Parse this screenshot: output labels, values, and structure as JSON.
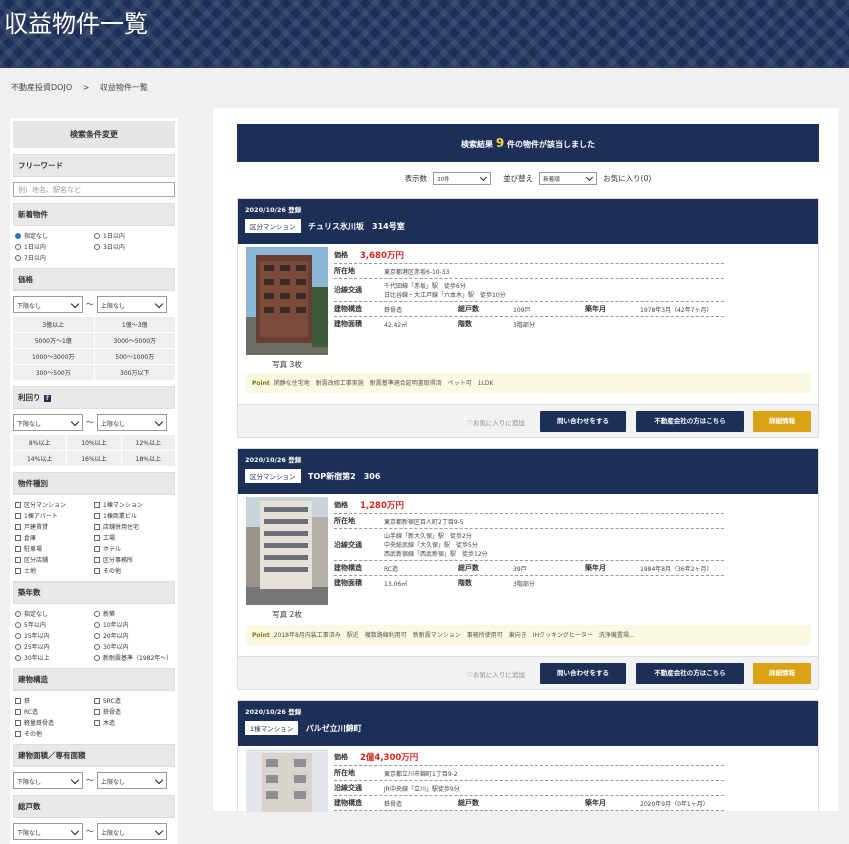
{
  "header": {
    "title": "収益物件一覧"
  },
  "breadcrumb": {
    "home": "不動産投資DOJO",
    "separator": ">",
    "current": "収益物件一覧"
  },
  "sidebar": {
    "title": "検索条件変更",
    "freeword": {
      "heading": "フリーワード",
      "placeholder": "例）地名、駅名など"
    },
    "new": {
      "heading": "新着物件",
      "options": [
        "指定なし",
        "1日以内",
        "7日以内",
        "1日以内",
        "3日以内"
      ]
    },
    "price": {
      "heading": "価格",
      "min": "下限なし",
      "tilde": "～",
      "max": "上限なし",
      "quick": [
        "3億以上",
        "1億～3億",
        "5000万～1億",
        "3000～5000万",
        "1000～3000万",
        "500～1000万",
        "300～500万",
        "300万以下"
      ]
    },
    "yield": {
      "heading": "利回り",
      "help": "?",
      "min": "下限なし",
      "tilde": "～",
      "max": "上限なし",
      "quick": [
        "8%以上",
        "10%以上",
        "12%以上",
        "14%以上",
        "16%以上",
        "18%以上"
      ]
    },
    "type": {
      "heading": "物件種別",
      "options": [
        "区分マンション",
        "1棟マンション",
        "1棟アパート",
        "1棟商業ビル",
        "戸建賃貸",
        "店舗併用住宅",
        "倉庫",
        "工場",
        "駐車場",
        "ホテル",
        "区分店舗",
        "区分事務所",
        "土地",
        "その他"
      ]
    },
    "age": {
      "heading": "築年数",
      "options": [
        "指定なし",
        "新築",
        "5年以内",
        "10年以内",
        "15年以内",
        "20年以内",
        "25年以内",
        "30年以内",
        "30年以上",
        "新耐震基準（1982年～）"
      ]
    },
    "structure": {
      "heading": "建物構造",
      "options": [
        "鉄",
        "SRC造",
        "RC造",
        "鉄骨造",
        "軽量鉄骨造",
        "木造",
        "その他"
      ]
    },
    "area": {
      "heading": "建物面積／専有面積",
      "min": "下限なし",
      "tilde": "～",
      "max": "上限なし"
    },
    "units": {
      "heading": "総戸数",
      "min": "下限なし",
      "tilde": "～",
      "max": "上限なし"
    }
  },
  "results": {
    "prefix": "検索結果",
    "count": "9",
    "suffix": "件の物件が該当しました"
  },
  "toolbar": {
    "per_page_label": "表示数",
    "per_page": "20件",
    "sort_label": "並び替え",
    "sort": "新着順",
    "favorites": "お気に入り(0)"
  },
  "listings": [
    {
      "date": "2020/10/26 登録",
      "type": "区分マンション",
      "name": "チュリス氷川坂　314号室",
      "price_label": "価格",
      "price": "3,680万円",
      "addr_label": "所在地",
      "addr": "東京都港区赤坂6-10-33",
      "train_label": "沿線交通",
      "train": [
        "千代田線「赤坂」駅　徒歩6分",
        "日比谷線・大江戸線「六本木」駅　徒歩10分"
      ],
      "struct_label": "建物構造",
      "struct": "鉄骨造",
      "units_label": "総戸数",
      "units": "109戸",
      "built_label": "築年月",
      "built": "1978年3月（42年7ヶ月）",
      "area_label": "建物面積",
      "area": "42.42㎡",
      "floors_label": "階数",
      "floors": "3階部分",
      "photos": "写真 3枚",
      "point_label": "Point",
      "point": "閑静な住宅地　耐震改修工事実施　耐震基準適合証明書取得済　ペット可　1LDK",
      "fav": "♡お気に入りに追加",
      "btn_contact": "問い合わせをする",
      "btn_agent": "不動産会社の方はこちら",
      "btn_detail": "詳細情報"
    },
    {
      "date": "2020/10/26 登録",
      "type": "区分マンション",
      "name": "TOP新宿第2　306",
      "price_label": "価格",
      "price": "1,280万円",
      "addr_label": "所在地",
      "addr": "東京都新宿区百人町2丁目9-5",
      "train_label": "沿線交通",
      "train": [
        "山手線「新大久保」駅　徒歩2分",
        "中央総武線「大久保」駅　徒歩5分",
        "西武新宿線「西武新宿」駅　徒歩12分"
      ],
      "struct_label": "建物構造",
      "struct": "RC造",
      "units_label": "総戸数",
      "units": "39戸",
      "built_label": "築年月",
      "built": "1984年8月（36年2ヶ月）",
      "area_label": "建物面積",
      "area": "13.06㎡",
      "floors_label": "階数",
      "floors": "3階部分",
      "photos": "写真 2枚",
      "point_label": "Point",
      "point": "2018年8月内装工事済み　駅近　複数路線利用可　新耐震マンション　事務所使用可　東向き　IHクッキングヒーター　洗浄機置場...",
      "fav": "♡お気に入りに追加",
      "btn_contact": "問い合わせをする",
      "btn_agent": "不動産会社の方はこちら",
      "btn_detail": "詳細情報"
    },
    {
      "date": "2020/10/26 登録",
      "type": "1棟マンション",
      "name": "パルゼ立川錦町",
      "price_label": "価格",
      "price": "2億4,300万円",
      "addr_label": "所在地",
      "addr": "東京都立川市錦町1丁目9-2",
      "train_label": "沿線交通",
      "train": [
        "JR中央線「立川」駅徒歩9分"
      ],
      "struct_label": "建物構造",
      "struct": "鉄骨造",
      "units_label": "総戸数",
      "built_label": "築年月",
      "built": "2020年9月（0年1ヶ月）"
    }
  ]
}
